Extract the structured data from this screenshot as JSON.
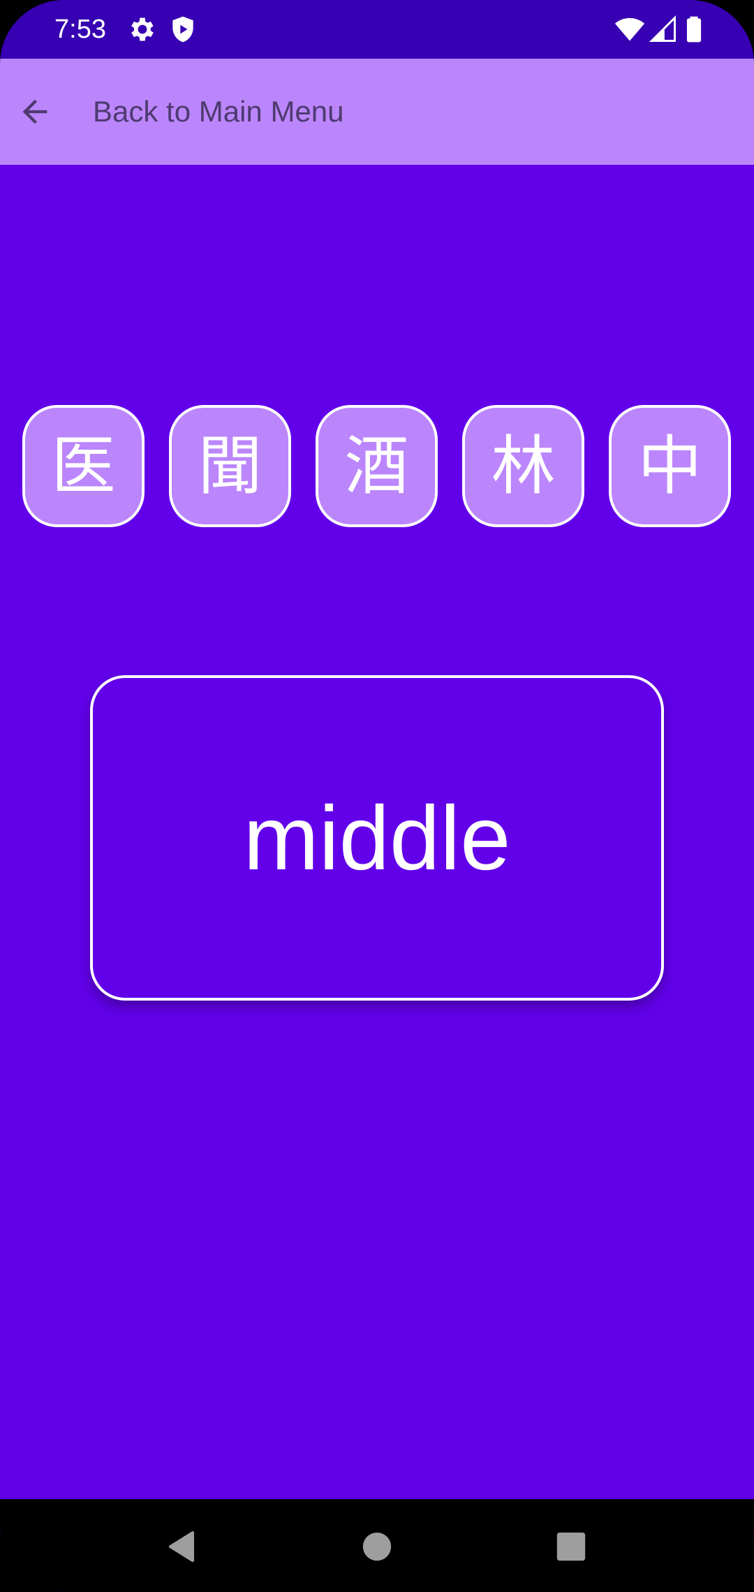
{
  "status_bar": {
    "time": "7:53",
    "icons_left": [
      "gear-icon",
      "shield-play-icon"
    ],
    "icons_right": [
      "wifi-icon",
      "signal-icon",
      "battery-icon"
    ]
  },
  "app_bar": {
    "back_icon": "arrow-back-icon",
    "title": "Back to Main Menu"
  },
  "kanji_options": [
    "医",
    "聞",
    "酒",
    "林",
    "中"
  ],
  "meaning_card": {
    "word": "middle"
  },
  "nav_bar": {
    "buttons": [
      "back-triangle-icon",
      "home-circle-icon",
      "recents-square-icon"
    ]
  },
  "colors": {
    "background": "#6200ea",
    "status_bar": "#3700b3",
    "app_bar": "#bb86fc",
    "tile": "#bb86fc",
    "tile_border": "#ffffff",
    "title_text": "#4e3a70"
  }
}
